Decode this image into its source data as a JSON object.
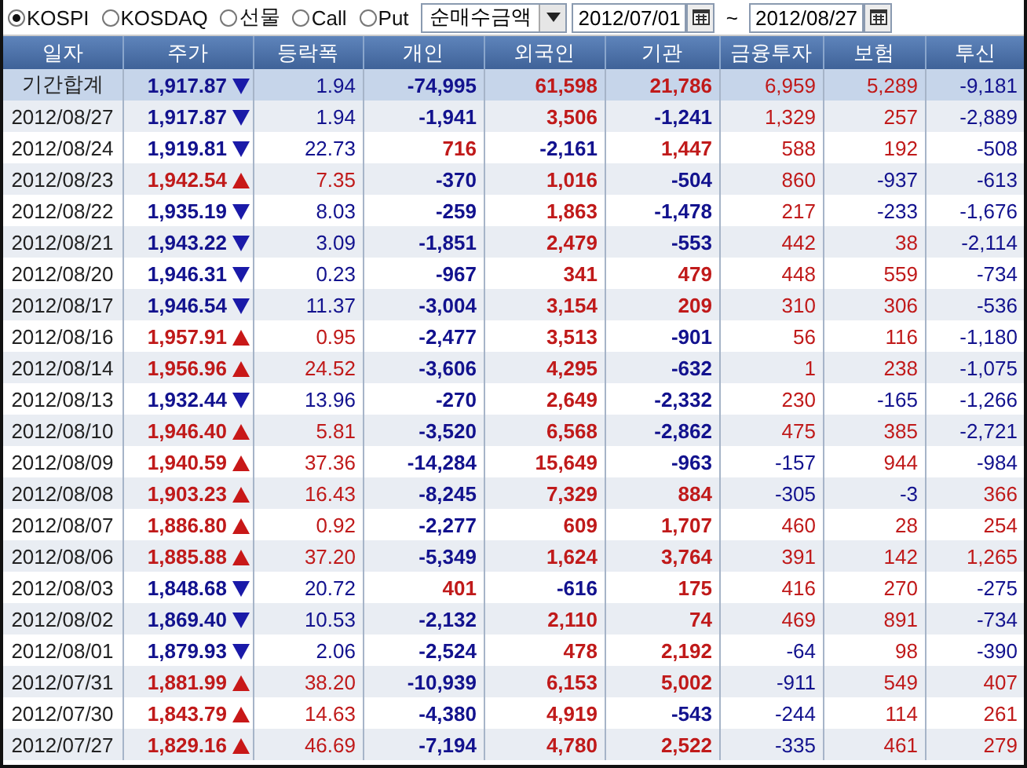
{
  "toolbar": {
    "markets": [
      {
        "label": "KOSPI",
        "selected": true
      },
      {
        "label": "KOSDAQ",
        "selected": false
      },
      {
        "label": "선물",
        "selected": false
      },
      {
        "label": "Call",
        "selected": false
      },
      {
        "label": "Put",
        "selected": false
      }
    ],
    "measure": "순매수금액",
    "date_from": "2012/07/01",
    "separator": "~",
    "date_to": "2012/08/27"
  },
  "table": {
    "columns": [
      "일자",
      "주가",
      "등락폭",
      "개인",
      "외국인",
      "기관",
      "금융투자",
      "보험",
      "투신"
    ],
    "rows": [
      {
        "date": "기간합계",
        "summary": true,
        "price": "1,917.87",
        "rising": false,
        "change": "1.94",
        "values": [
          {
            "text": "-74,995",
            "negative": true
          },
          {
            "text": "61,598",
            "negative": false
          },
          {
            "text": "21,786",
            "negative": false
          },
          {
            "text": "6,959",
            "negative": false
          },
          {
            "text": "5,289",
            "negative": false
          },
          {
            "text": "-9,181",
            "negative": true
          }
        ]
      },
      {
        "date": "2012/08/27",
        "summary": false,
        "price": "1,917.87",
        "rising": false,
        "change": "1.94",
        "values": [
          {
            "text": "-1,941",
            "negative": true
          },
          {
            "text": "3,506",
            "negative": false
          },
          {
            "text": "-1,241",
            "negative": true
          },
          {
            "text": "1,329",
            "negative": false
          },
          {
            "text": "257",
            "negative": false
          },
          {
            "text": "-2,889",
            "negative": true
          }
        ]
      },
      {
        "date": "2012/08/24",
        "summary": false,
        "price": "1,919.81",
        "rising": false,
        "change": "22.73",
        "values": [
          {
            "text": "716",
            "negative": false
          },
          {
            "text": "-2,161",
            "negative": true
          },
          {
            "text": "1,447",
            "negative": false
          },
          {
            "text": "588",
            "negative": false
          },
          {
            "text": "192",
            "negative": false
          },
          {
            "text": "-508",
            "negative": true
          }
        ]
      },
      {
        "date": "2012/08/23",
        "summary": false,
        "price": "1,942.54",
        "rising": true,
        "change": "7.35",
        "values": [
          {
            "text": "-370",
            "negative": true
          },
          {
            "text": "1,016",
            "negative": false
          },
          {
            "text": "-504",
            "negative": true
          },
          {
            "text": "860",
            "negative": false
          },
          {
            "text": "-937",
            "negative": true
          },
          {
            "text": "-613",
            "negative": true
          }
        ]
      },
      {
        "date": "2012/08/22",
        "summary": false,
        "price": "1,935.19",
        "rising": false,
        "change": "8.03",
        "values": [
          {
            "text": "-259",
            "negative": true
          },
          {
            "text": "1,863",
            "negative": false
          },
          {
            "text": "-1,478",
            "negative": true
          },
          {
            "text": "217",
            "negative": false
          },
          {
            "text": "-233",
            "negative": true
          },
          {
            "text": "-1,676",
            "negative": true
          }
        ]
      },
      {
        "date": "2012/08/21",
        "summary": false,
        "price": "1,943.22",
        "rising": false,
        "change": "3.09",
        "values": [
          {
            "text": "-1,851",
            "negative": true
          },
          {
            "text": "2,479",
            "negative": false
          },
          {
            "text": "-553",
            "negative": true
          },
          {
            "text": "442",
            "negative": false
          },
          {
            "text": "38",
            "negative": false
          },
          {
            "text": "-2,114",
            "negative": true
          }
        ]
      },
      {
        "date": "2012/08/20",
        "summary": false,
        "price": "1,946.31",
        "rising": false,
        "change": "0.23",
        "values": [
          {
            "text": "-967",
            "negative": true
          },
          {
            "text": "341",
            "negative": false
          },
          {
            "text": "479",
            "negative": false
          },
          {
            "text": "448",
            "negative": false
          },
          {
            "text": "559",
            "negative": false
          },
          {
            "text": "-734",
            "negative": true
          }
        ]
      },
      {
        "date": "2012/08/17",
        "summary": false,
        "price": "1,946.54",
        "rising": false,
        "change": "11.37",
        "values": [
          {
            "text": "-3,004",
            "negative": true
          },
          {
            "text": "3,154",
            "negative": false
          },
          {
            "text": "209",
            "negative": false
          },
          {
            "text": "310",
            "negative": false
          },
          {
            "text": "306",
            "negative": false
          },
          {
            "text": "-536",
            "negative": true
          }
        ]
      },
      {
        "date": "2012/08/16",
        "summary": false,
        "price": "1,957.91",
        "rising": true,
        "change": "0.95",
        "values": [
          {
            "text": "-2,477",
            "negative": true
          },
          {
            "text": "3,513",
            "negative": false
          },
          {
            "text": "-901",
            "negative": true
          },
          {
            "text": "56",
            "negative": false
          },
          {
            "text": "116",
            "negative": false
          },
          {
            "text": "-1,180",
            "negative": true
          }
        ]
      },
      {
        "date": "2012/08/14",
        "summary": false,
        "price": "1,956.96",
        "rising": true,
        "change": "24.52",
        "values": [
          {
            "text": "-3,606",
            "negative": true
          },
          {
            "text": "4,295",
            "negative": false
          },
          {
            "text": "-632",
            "negative": true
          },
          {
            "text": "1",
            "negative": false
          },
          {
            "text": "238",
            "negative": false
          },
          {
            "text": "-1,075",
            "negative": true
          }
        ]
      },
      {
        "date": "2012/08/13",
        "summary": false,
        "price": "1,932.44",
        "rising": false,
        "change": "13.96",
        "values": [
          {
            "text": "-270",
            "negative": true
          },
          {
            "text": "2,649",
            "negative": false
          },
          {
            "text": "-2,332",
            "negative": true
          },
          {
            "text": "230",
            "negative": false
          },
          {
            "text": "-165",
            "negative": true
          },
          {
            "text": "-1,266",
            "negative": true
          }
        ]
      },
      {
        "date": "2012/08/10",
        "summary": false,
        "price": "1,946.40",
        "rising": true,
        "change": "5.81",
        "values": [
          {
            "text": "-3,520",
            "negative": true
          },
          {
            "text": "6,568",
            "negative": false
          },
          {
            "text": "-2,862",
            "negative": true
          },
          {
            "text": "475",
            "negative": false
          },
          {
            "text": "385",
            "negative": false
          },
          {
            "text": "-2,721",
            "negative": true
          }
        ]
      },
      {
        "date": "2012/08/09",
        "summary": false,
        "price": "1,940.59",
        "rising": true,
        "change": "37.36",
        "values": [
          {
            "text": "-14,284",
            "negative": true
          },
          {
            "text": "15,649",
            "negative": false
          },
          {
            "text": "-963",
            "negative": true
          },
          {
            "text": "-157",
            "negative": true
          },
          {
            "text": "944",
            "negative": false
          },
          {
            "text": "-984",
            "negative": true
          }
        ]
      },
      {
        "date": "2012/08/08",
        "summary": false,
        "price": "1,903.23",
        "rising": true,
        "change": "16.43",
        "values": [
          {
            "text": "-8,245",
            "negative": true
          },
          {
            "text": "7,329",
            "negative": false
          },
          {
            "text": "884",
            "negative": false
          },
          {
            "text": "-305",
            "negative": true
          },
          {
            "text": "-3",
            "negative": true
          },
          {
            "text": "366",
            "negative": false
          }
        ]
      },
      {
        "date": "2012/08/07",
        "summary": false,
        "price": "1,886.80",
        "rising": true,
        "change": "0.92",
        "values": [
          {
            "text": "-2,277",
            "negative": true
          },
          {
            "text": "609",
            "negative": false
          },
          {
            "text": "1,707",
            "negative": false
          },
          {
            "text": "460",
            "negative": false
          },
          {
            "text": "28",
            "negative": false
          },
          {
            "text": "254",
            "negative": false
          }
        ]
      },
      {
        "date": "2012/08/06",
        "summary": false,
        "price": "1,885.88",
        "rising": true,
        "change": "37.20",
        "values": [
          {
            "text": "-5,349",
            "negative": true
          },
          {
            "text": "1,624",
            "negative": false
          },
          {
            "text": "3,764",
            "negative": false
          },
          {
            "text": "391",
            "negative": false
          },
          {
            "text": "142",
            "negative": false
          },
          {
            "text": "1,265",
            "negative": false
          }
        ]
      },
      {
        "date": "2012/08/03",
        "summary": false,
        "price": "1,848.68",
        "rising": false,
        "change": "20.72",
        "values": [
          {
            "text": "401",
            "negative": false
          },
          {
            "text": "-616",
            "negative": true
          },
          {
            "text": "175",
            "negative": false
          },
          {
            "text": "416",
            "negative": false
          },
          {
            "text": "270",
            "negative": false
          },
          {
            "text": "-275",
            "negative": true
          }
        ]
      },
      {
        "date": "2012/08/02",
        "summary": false,
        "price": "1,869.40",
        "rising": false,
        "change": "10.53",
        "values": [
          {
            "text": "-2,132",
            "negative": true
          },
          {
            "text": "2,110",
            "negative": false
          },
          {
            "text": "74",
            "negative": false
          },
          {
            "text": "469",
            "negative": false
          },
          {
            "text": "891",
            "negative": false
          },
          {
            "text": "-734",
            "negative": true
          }
        ]
      },
      {
        "date": "2012/08/01",
        "summary": false,
        "price": "1,879.93",
        "rising": false,
        "change": "2.06",
        "values": [
          {
            "text": "-2,524",
            "negative": true
          },
          {
            "text": "478",
            "negative": false
          },
          {
            "text": "2,192",
            "negative": false
          },
          {
            "text": "-64",
            "negative": true
          },
          {
            "text": "98",
            "negative": false
          },
          {
            "text": "-390",
            "negative": true
          }
        ]
      },
      {
        "date": "2012/07/31",
        "summary": false,
        "price": "1,881.99",
        "rising": true,
        "change": "38.20",
        "values": [
          {
            "text": "-10,939",
            "negative": true
          },
          {
            "text": "6,153",
            "negative": false
          },
          {
            "text": "5,002",
            "negative": false
          },
          {
            "text": "-911",
            "negative": true
          },
          {
            "text": "549",
            "negative": false
          },
          {
            "text": "407",
            "negative": false
          }
        ]
      },
      {
        "date": "2012/07/30",
        "summary": false,
        "price": "1,843.79",
        "rising": true,
        "change": "14.63",
        "values": [
          {
            "text": "-4,380",
            "negative": true
          },
          {
            "text": "4,919",
            "negative": false
          },
          {
            "text": "-543",
            "negative": true
          },
          {
            "text": "-244",
            "negative": true
          },
          {
            "text": "114",
            "negative": false
          },
          {
            "text": "261",
            "negative": false
          }
        ]
      },
      {
        "date": "2012/07/27",
        "summary": false,
        "price": "1,829.16",
        "rising": true,
        "change": "46.69",
        "values": [
          {
            "text": "-7,194",
            "negative": true
          },
          {
            "text": "4,780",
            "negative": false
          },
          {
            "text": "2,522",
            "negative": false
          },
          {
            "text": "-335",
            "negative": true
          },
          {
            "text": "461",
            "negative": false
          },
          {
            "text": "279",
            "negative": false
          }
        ]
      }
    ]
  }
}
